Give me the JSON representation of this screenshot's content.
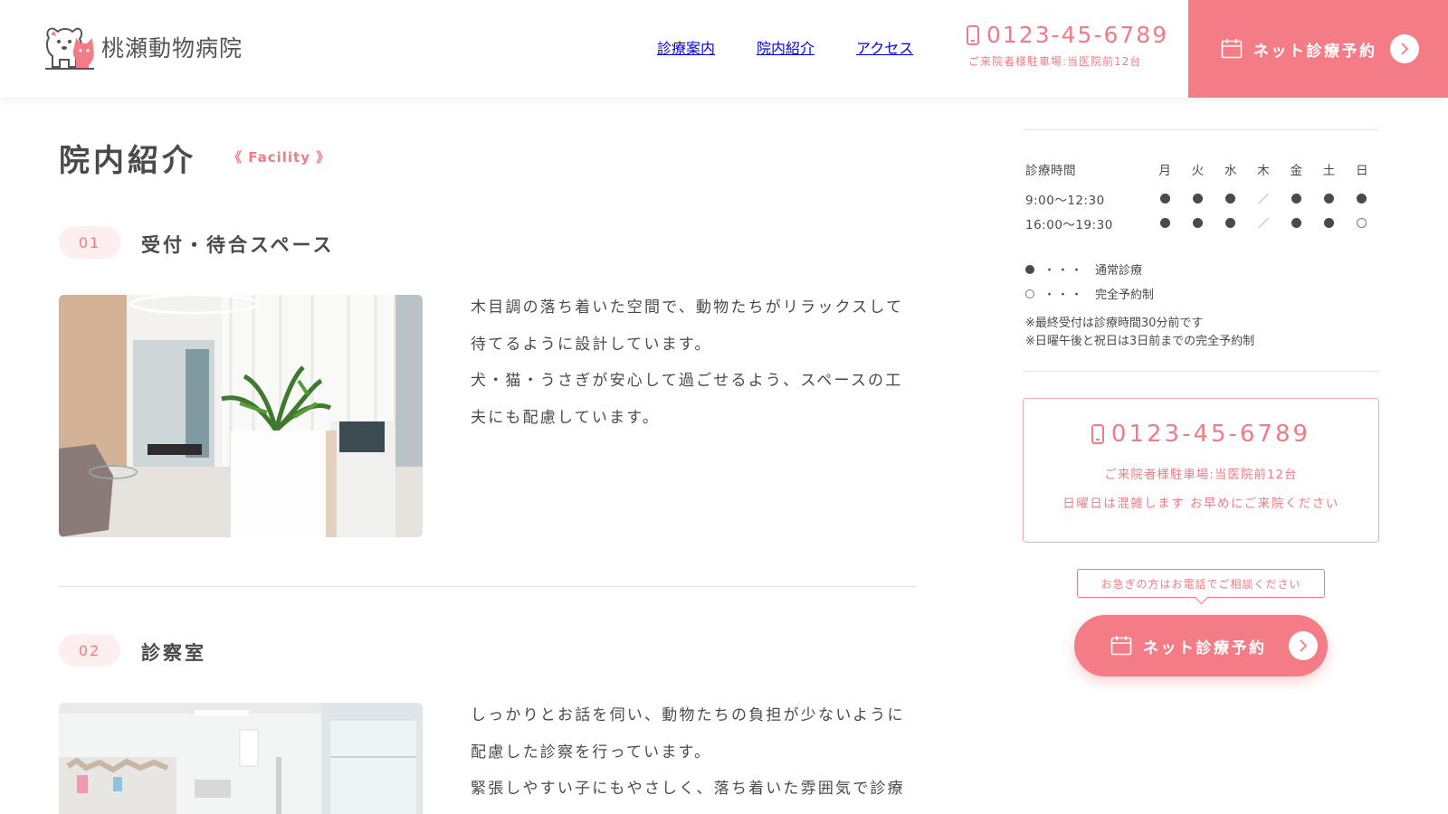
{
  "header": {
    "logo_text": "桃瀬動物病院",
    "nav": [
      "診療案内",
      "院内紹介",
      "アクセス"
    ],
    "phone": "0123-45-6789",
    "parking": "ご来院者様駐車場:当医院前12台",
    "reserve_label": "ネット診療予約"
  },
  "page": {
    "title": "院内紹介",
    "subtitle": "《 Facility 》"
  },
  "sections": [
    {
      "num": "01",
      "title": "受付・待合スペース",
      "lines": [
        "木目調の落ち着いた空間で、動物たちがリラックスして",
        "待てるように設計しています。",
        "犬・猫・うさぎが安心して過ごせるよう、スペースの工",
        "夫にも配慮しています。"
      ]
    },
    {
      "num": "02",
      "title": "診察室",
      "lines": [
        "しっかりとお話を伺い、動物たちの負担が少ないように",
        "配慮した診察を行っています。",
        "緊張しやすい子にもやさしく、落ち着いた雰囲気で診療"
      ]
    }
  ],
  "sidebar": {
    "hours_label": "診療時間",
    "days": [
      "月",
      "火",
      "水",
      "木",
      "金",
      "土",
      "日"
    ],
    "rows": [
      {
        "time": "9:00〜12:30",
        "marks": [
          "●",
          "●",
          "●",
          "／",
          "●",
          "●",
          "●"
        ]
      },
      {
        "time": "16:00〜19:30",
        "marks": [
          "●",
          "●",
          "●",
          "／",
          "●",
          "●",
          "○"
        ]
      }
    ],
    "legend": [
      {
        "mark": "●",
        "dots": "・・・",
        "text": "通常診療"
      },
      {
        "mark": "○",
        "dots": "・・・",
        "text": "完全予約制"
      }
    ],
    "notes": [
      "※最終受付は診療時間30分前です",
      "※日曜午後と祝日は3日前までの完全予約制"
    ],
    "box_phone": "0123-45-6789",
    "box_line1": "ご来院者様駐車場:当医院前12台",
    "box_line2": "日曜日は混雑します お早めにご来院ください",
    "bubble": "お急ぎの方はお電話でご相談ください",
    "reserve_label": "ネット診療予約"
  },
  "colors": {
    "accent": "#f47c86",
    "accent_text": "#f27b85",
    "badge_bg": "#fdeef0",
    "text": "#4a4a4a"
  },
  "icons": [
    "logo-dog-cat-icon",
    "phone-icon",
    "calendar-icon",
    "chevron-right-icon"
  ]
}
